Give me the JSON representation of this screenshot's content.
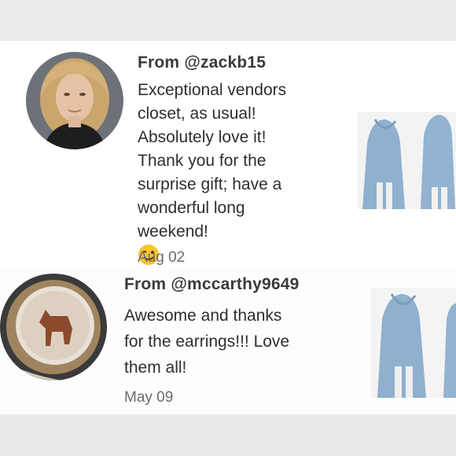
{
  "reviews": [
    {
      "from": "From @zackb15",
      "lines": [
        "Exceptional vendors",
        "closet, as usual!",
        "Absolutely love it!",
        "Thank you for the",
        "surprise gift; have a",
        "wonderful long",
        "weekend!"
      ],
      "date": "Aug 02"
    },
    {
      "from": "From @mccarthy9649",
      "lines": [
        "Awesome and thanks",
        "for the earrings!!! Love",
        "them all!"
      ],
      "date": "May 09"
    }
  ],
  "icons": [
    "wink-emoji-icon",
    "cherry-blossom-icon"
  ],
  "colors": {
    "card": "#ffffff",
    "background": "#e9e9eb",
    "denim": "#8fb0cf"
  }
}
